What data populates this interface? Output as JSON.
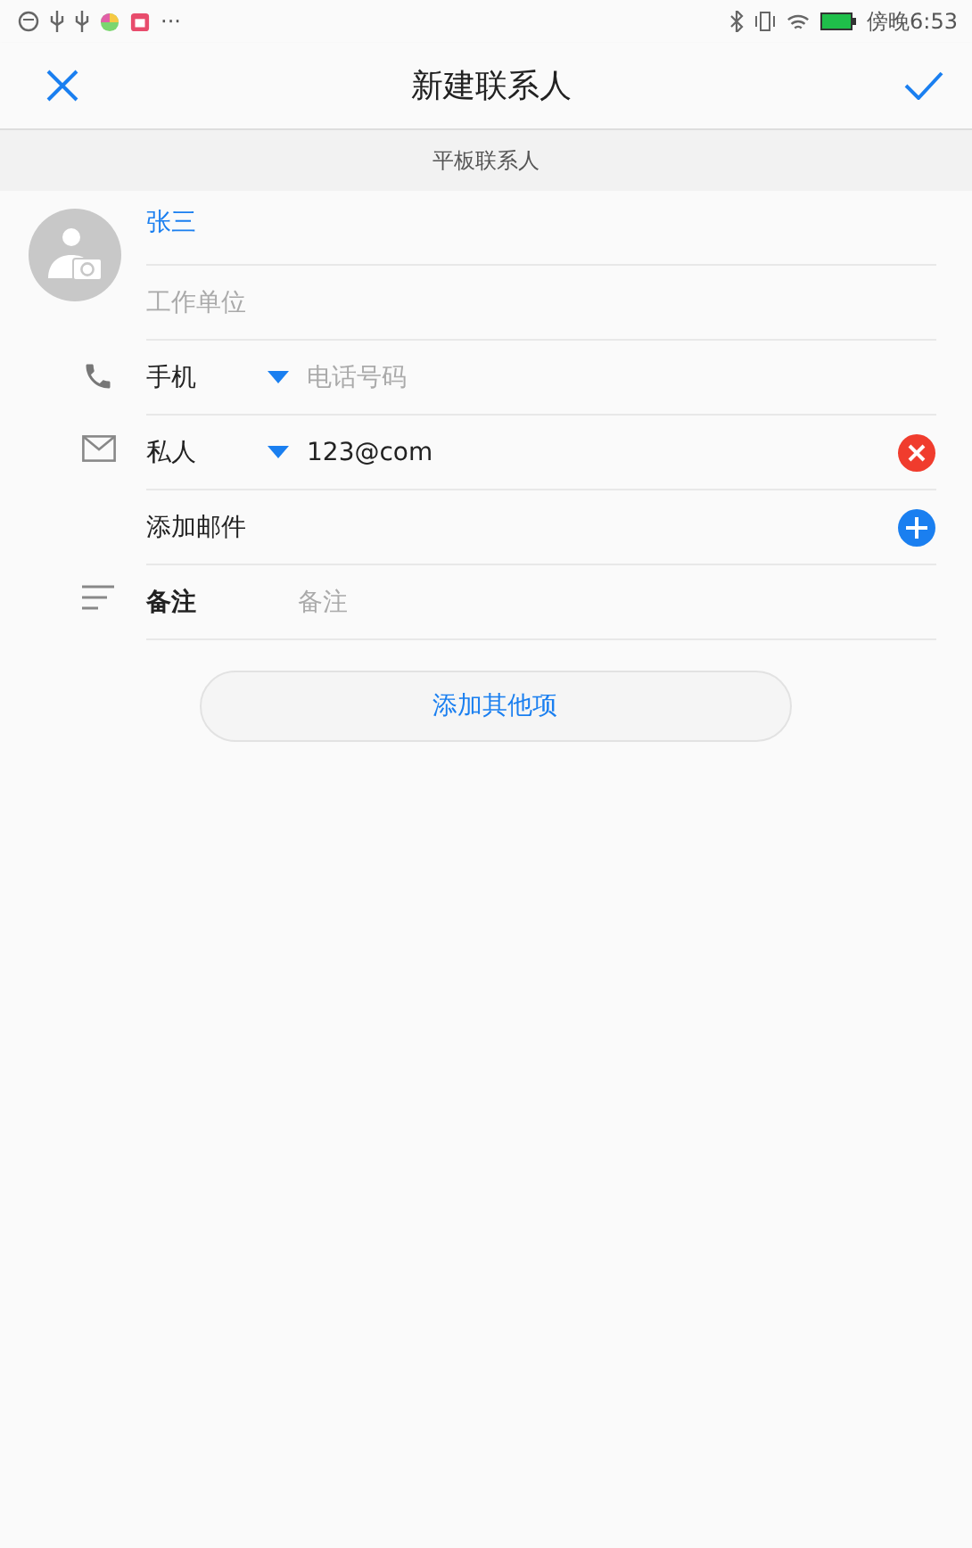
{
  "status_bar": {
    "overflow": "···",
    "time": "傍晚6:53"
  },
  "header": {
    "title": "新建联系人"
  },
  "account": {
    "label": "平板联系人"
  },
  "name_field": {
    "value": "张三"
  },
  "company_field": {
    "placeholder": "工作单位"
  },
  "rows": [
    {
      "kind": "phone",
      "type_label": "手机",
      "placeholder": "电话号码"
    },
    {
      "kind": "email",
      "type_label": "私人",
      "value": "123@com"
    },
    {
      "kind": "add",
      "label": "添加邮件"
    },
    {
      "kind": "note",
      "label": "备注",
      "placeholder": "备注"
    }
  ],
  "add_button": {
    "label": "添加其他项"
  }
}
